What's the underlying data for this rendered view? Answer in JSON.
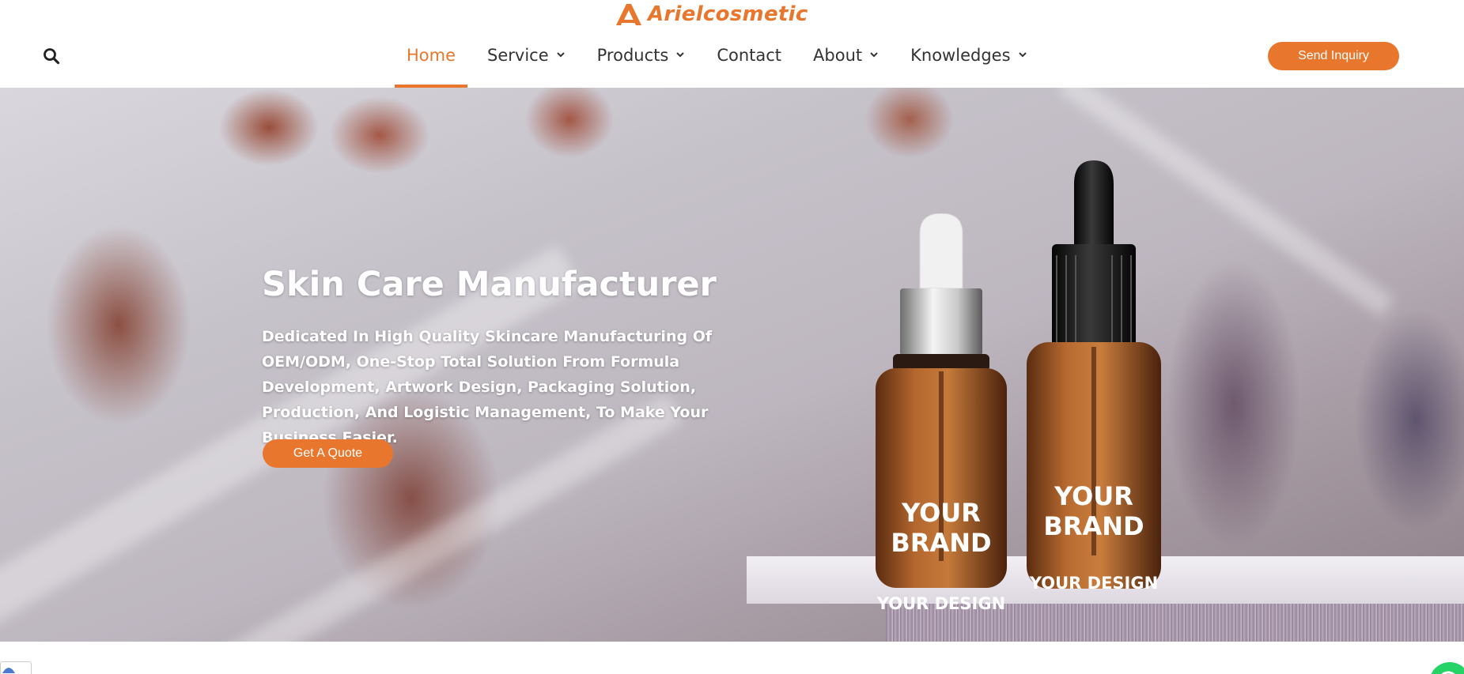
{
  "header": {
    "logo_text": "Arielcosmetic",
    "nav": [
      {
        "label": "Home",
        "active": true,
        "has_dropdown": false
      },
      {
        "label": "Service",
        "active": false,
        "has_dropdown": true
      },
      {
        "label": "Products",
        "active": false,
        "has_dropdown": true
      },
      {
        "label": "Contact",
        "active": false,
        "has_dropdown": false
      },
      {
        "label": "About",
        "active": false,
        "has_dropdown": true
      },
      {
        "label": "Knowledges",
        "active": false,
        "has_dropdown": true
      }
    ],
    "inquiry_label": "Send Inquiry",
    "search_icon": "search-icon"
  },
  "hero": {
    "title": "Skin Care Manufacturer",
    "description": "Dedicated In High Quality Skincare Manufacturing Of OEM/ODM, One-Stop Total Solution From Formula Development, Artwork Design, Packaging Solution, Production, And Logistic Management, To Make Your Business Easier.",
    "quote_label": "Get A Quote",
    "bottles": [
      {
        "brand": "YOUR BRAND",
        "design": "YOUR  DESIGN"
      },
      {
        "brand": "YOUR BRAND",
        "design": "YOUR  DESIGN"
      }
    ]
  },
  "colors": {
    "accent": "#e8762c",
    "nav_text": "#333333",
    "chat": "#25d366"
  }
}
